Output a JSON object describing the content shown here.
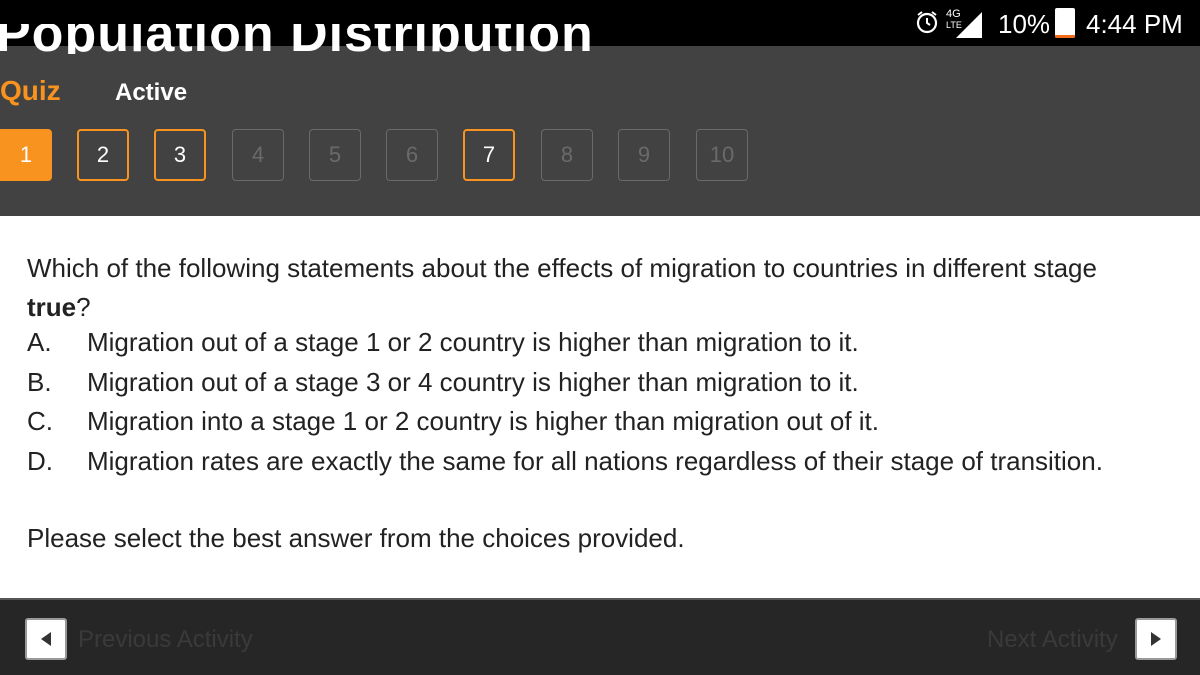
{
  "status_bar": {
    "network_type": "4G",
    "network_subtype": "LTE",
    "battery_percent": "10%",
    "battery_level": 0.1,
    "time": "4:44 PM",
    "icons": [
      "alarm-icon",
      "signal-icon",
      "battery-icon"
    ]
  },
  "header": {
    "lesson_title": "Population Distribution",
    "activity_type": "Quiz",
    "status": "Active",
    "accent_color": "#f7931e",
    "question_nav": [
      {
        "label": "1",
        "state": "current"
      },
      {
        "label": "2",
        "state": "answered"
      },
      {
        "label": "3",
        "state": "answered"
      },
      {
        "label": "4",
        "state": "unanswered"
      },
      {
        "label": "5",
        "state": "unanswered"
      },
      {
        "label": "6",
        "state": "unanswered"
      },
      {
        "label": "7",
        "state": "answered"
      },
      {
        "label": "8",
        "state": "unanswered"
      },
      {
        "label": "9",
        "state": "unanswered"
      },
      {
        "label": "10",
        "state": "unanswered"
      }
    ]
  },
  "question": {
    "text_before_bold": "Which of the following statements about the effects of migration to countries in different stage",
    "bold": "true",
    "text_after_bold": "?",
    "options": [
      {
        "letter": "A.",
        "text": "Migration out of a stage 1 or 2 country is higher than migration to it."
      },
      {
        "letter": "B.",
        "text": "Migration out of a stage 3 or 4 country is higher than migration to it."
      },
      {
        "letter": "C.",
        "text": "Migration into a stage 1 or 2 country is higher than migration out of it."
      },
      {
        "letter": "D.",
        "text": "Migration rates are exactly the same for all nations regardless of their stage of transition."
      }
    ],
    "instruction": "Please select the best answer from the choices provided."
  },
  "footer": {
    "previous_label": "Previous Activity",
    "next_label": "Next Activity"
  }
}
